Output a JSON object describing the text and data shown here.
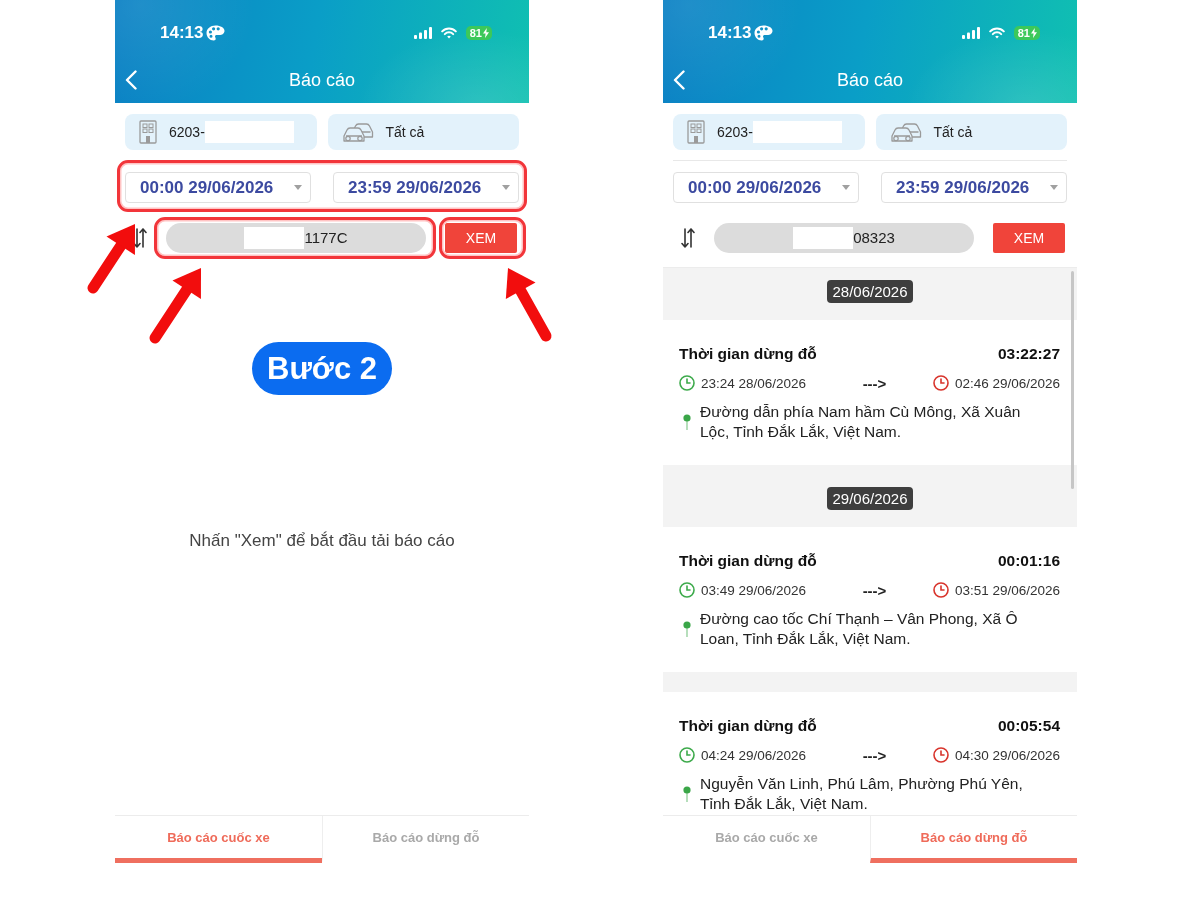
{
  "screens": [
    {
      "status_bar": {
        "time": "14:13",
        "battery": "81"
      },
      "header": {
        "title": "Báo cáo"
      },
      "filters": [
        {
          "kind": "company",
          "value": "6203-",
          "redacted": true
        },
        {
          "kind": "vehicles",
          "value": "Tất cả",
          "redacted": false
        }
      ],
      "date_range": {
        "from": "00:00 29/06/2026",
        "to": "23:59 29/06/2026",
        "highlighted": true
      },
      "plate_field": {
        "value": "1177C",
        "redacted": true,
        "highlighted": true
      },
      "view_button": {
        "label": "XEM",
        "highlighted": true
      },
      "step_badge": "Bước 2",
      "empty_message": "Nhấn \"Xem\" để bắt đầu tải báo cáo",
      "tabs": [
        {
          "label": "Báo cáo cuốc xe",
          "selected": true
        },
        {
          "label": "Báo cáo dừng đỗ",
          "selected": false
        }
      ]
    },
    {
      "status_bar": {
        "time": "14:13",
        "battery": "81"
      },
      "header": {
        "title": "Báo cáo"
      },
      "filters": [
        {
          "kind": "company",
          "value": "6203-",
          "redacted": true
        },
        {
          "kind": "vehicles",
          "value": "Tất cả",
          "redacted": false
        }
      ],
      "date_range": {
        "from": "00:00 29/06/2026",
        "to": "23:59 29/06/2026",
        "highlighted": false
      },
      "plate_field": {
        "value": "08323",
        "redacted": true,
        "highlighted": false
      },
      "view_button": {
        "label": "XEM",
        "highlighted": false
      },
      "stop_groups": [
        {
          "date": "28/06/2026",
          "stops": [
            {
              "title": "Thời gian dừng đỗ",
              "duration": "03:22:27",
              "start": "23:24 28/06/2026",
              "arrow": "--->",
              "end": "02:46 29/06/2026",
              "address": "Đường dẫn phía Nam hầm Cù Mông, Xã Xuân Lộc, Tỉnh Đắk Lắk, Việt Nam."
            }
          ]
        },
        {
          "date": "29/06/2026",
          "stops": [
            {
              "title": "Thời gian dừng đỗ",
              "duration": "00:01:16",
              "start": "03:49 29/06/2026",
              "arrow": "--->",
              "end": "03:51 29/06/2026",
              "address": "Đường cao tốc Chí Thạnh – Vân Phong, Xã Ô Loan, Tỉnh Đắk Lắk, Việt Nam."
            },
            {
              "title": "Thời gian dừng đỗ",
              "duration": "00:05:54",
              "start": "04:24 29/06/2026",
              "arrow": "--->",
              "end": "04:30 29/06/2026",
              "address": "Nguyễn Văn Linh, Phú Lâm, Phường Phú Yên, Tỉnh Đắk Lắk, Việt Nam."
            }
          ]
        }
      ],
      "tabs": [
        {
          "label": "Báo cáo cuốc xe",
          "selected": false
        },
        {
          "label": "Báo cáo dừng đỗ",
          "selected": true
        }
      ]
    }
  ]
}
